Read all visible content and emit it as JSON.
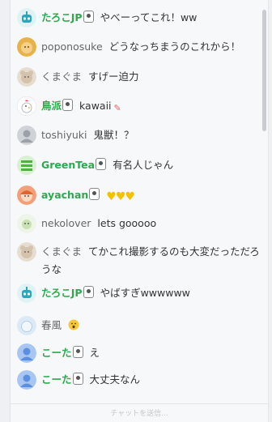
{
  "chat": {
    "messages": [
      {
        "name": "たろこJP",
        "text": "やべーってこれ！ww"
      },
      {
        "name": "poponosuke",
        "text": "どうなっちまうのこれから！"
      },
      {
        "name": "くまぐま",
        "text": "すげー迫力"
      },
      {
        "name": "鳥派",
        "text": "kawaii"
      },
      {
        "name": "toshiyuki",
        "text": "鬼獣！？"
      },
      {
        "name": "GreenTea",
        "text": "有名人じゃん"
      },
      {
        "name": "ayachan",
        "text": ""
      },
      {
        "name": "nekolover",
        "text": "lets gooooo"
      },
      {
        "name": "くまぐま",
        "text": "てかこれ撮影するのも大変だっただろうな"
      },
      {
        "name": "たろこJP",
        "text": "やばすぎwwwwww"
      },
      {
        "name": "春風",
        "text": ""
      },
      {
        "name": "こーた",
        "text": "え"
      },
      {
        "name": "こーた",
        "text": "大丈夫なん"
      }
    ],
    "input_placeholder": "チャットを送信..."
  }
}
